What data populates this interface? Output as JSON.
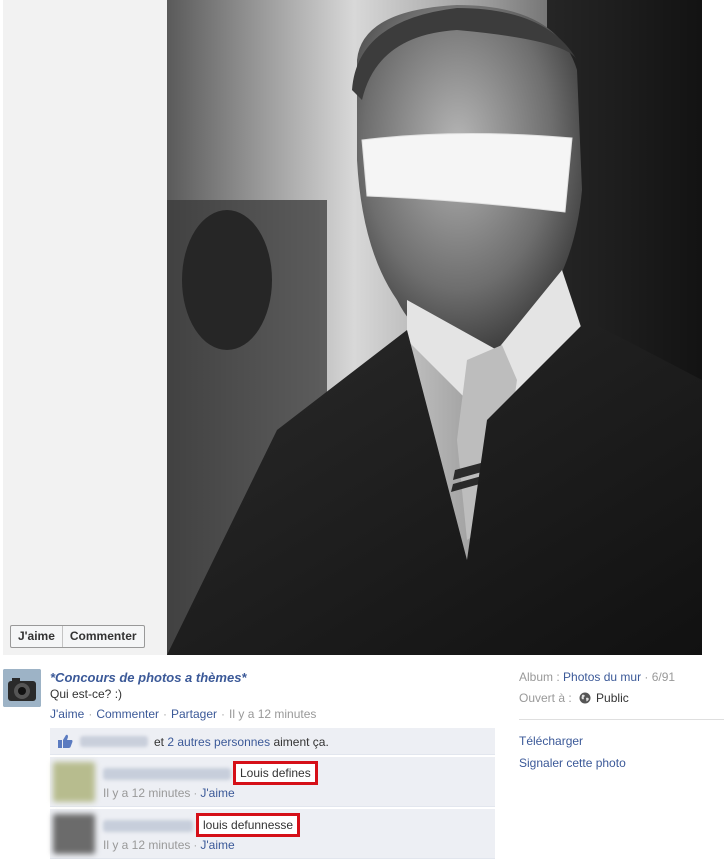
{
  "photo_actions": {
    "like_label": "J'aime",
    "comment_label": "Commenter"
  },
  "post": {
    "author": "*Concours de photos a thèmes*",
    "caption": "Qui est-ce? :)",
    "actions": {
      "like": "J'aime",
      "comment": "Commenter",
      "share": "Partager",
      "time": "Il y a 12 minutes"
    }
  },
  "likes": {
    "connector": "et",
    "others_link": "2 autres personnes",
    "suffix": "aiment ça."
  },
  "comments": [
    {
      "text": "Louis defines",
      "time": "Il y a 12 minutes",
      "like": "J'aime"
    },
    {
      "text": "louis defunnesse",
      "time": "Il y a 12 minutes",
      "like": "J'aime"
    }
  ],
  "sidebar": {
    "album_label": "Album",
    "album_link": "Photos du mur",
    "album_position": "6/91",
    "audience_label": "Ouvert à",
    "audience_value": "Public",
    "download": "Télécharger",
    "report": "Signaler cette photo"
  },
  "colors": {
    "link": "#3b5998",
    "highlight_box": "#d50f18",
    "ufi_bg": "#edeff4"
  },
  "icons": [
    "like-thumb-icon",
    "globe-icon"
  ]
}
